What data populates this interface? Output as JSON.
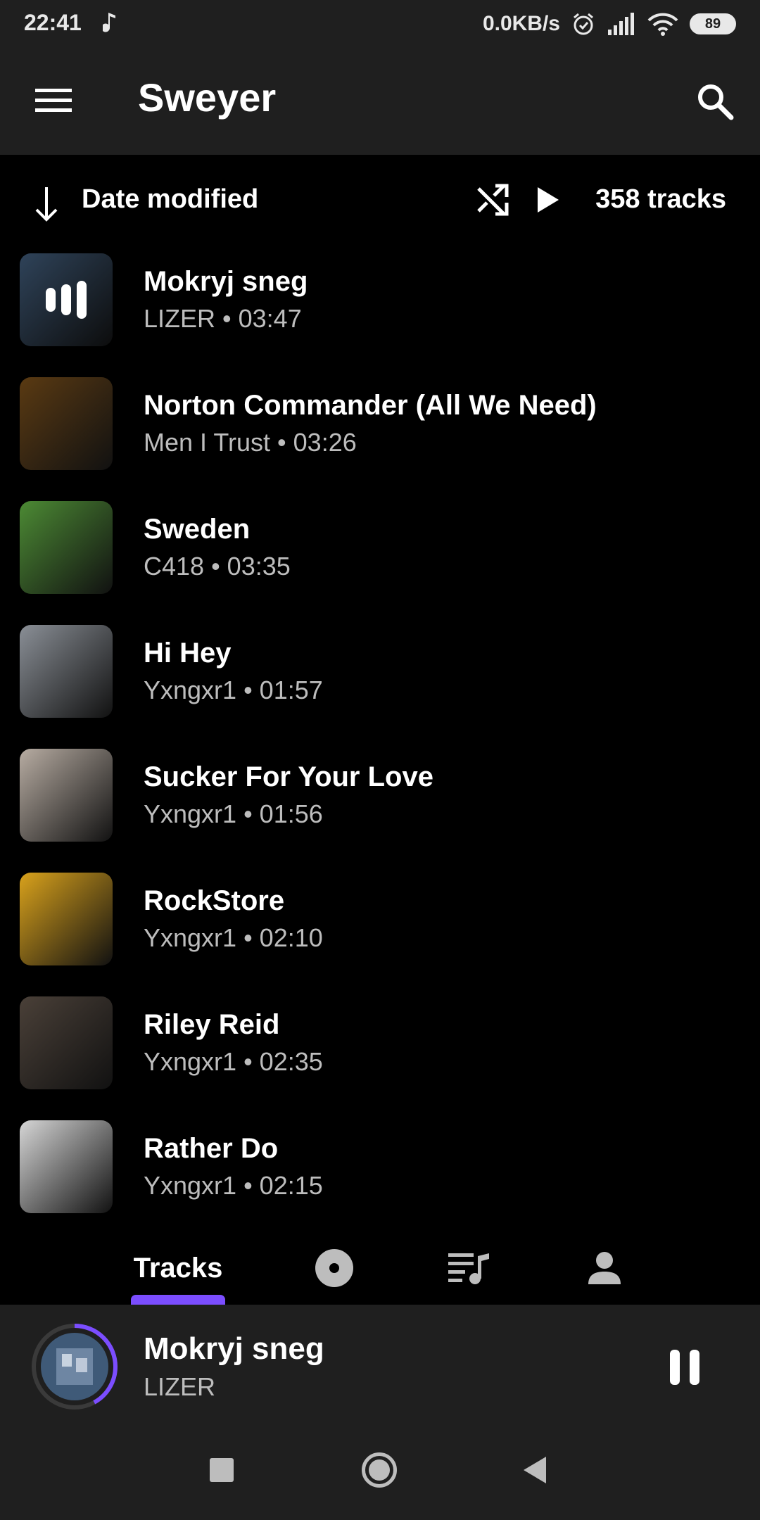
{
  "status_bar": {
    "time": "22:41",
    "speed": "0.0KB/s",
    "battery": "89"
  },
  "app_bar": {
    "title": "Sweyer",
    "menu_icon": "hamburger-menu-icon",
    "search_icon": "search-icon"
  },
  "sort_row": {
    "sort_label": "Date modified",
    "track_count": "358 tracks",
    "icons": [
      "arrow-down-icon",
      "shuffle-icon",
      "play-icon"
    ]
  },
  "tracks": [
    {
      "title": "Mokryj sneg",
      "subtitle": "LIZER • 03:47",
      "art_color": "#3f5a78",
      "playing": true
    },
    {
      "title": "Norton Commander (All We Need)",
      "subtitle": "Men I Trust • 03:26",
      "art_color": "#5a3a12"
    },
    {
      "title": "Sweden",
      "subtitle": "C418 • 03:35",
      "art_color": "#4c8a34"
    },
    {
      "title": "Hi Hey",
      "subtitle": "Yxngxr1 • 01:57",
      "art_color": "#8a8f96"
    },
    {
      "title": "Sucker For Your Love",
      "subtitle": "Yxngxr1 • 01:56",
      "art_color": "#b7aca2"
    },
    {
      "title": "RockStore",
      "subtitle": "Yxngxr1 • 02:10",
      "art_color": "#d9a21c"
    },
    {
      "title": "Riley Reid",
      "subtitle": "Yxngxr1 • 02:35",
      "art_color": "#4a4038"
    },
    {
      "title": "Rather Do",
      "subtitle": "Yxngxr1 • 02:15",
      "art_color": "#d6d6d6"
    }
  ],
  "tabs": {
    "active_label": "Tracks",
    "icons": [
      "album-icon",
      "playlist-icon",
      "artist-icon"
    ]
  },
  "mini_player": {
    "title": "Mokryj sneg",
    "artist": "LIZER",
    "progress": 0.42,
    "accent": "#7b4dff"
  },
  "colors": {
    "background": "#000000",
    "surface": "#1f1f1f",
    "accent": "#7b4dff",
    "secondary_text": "#bdbdbd"
  }
}
